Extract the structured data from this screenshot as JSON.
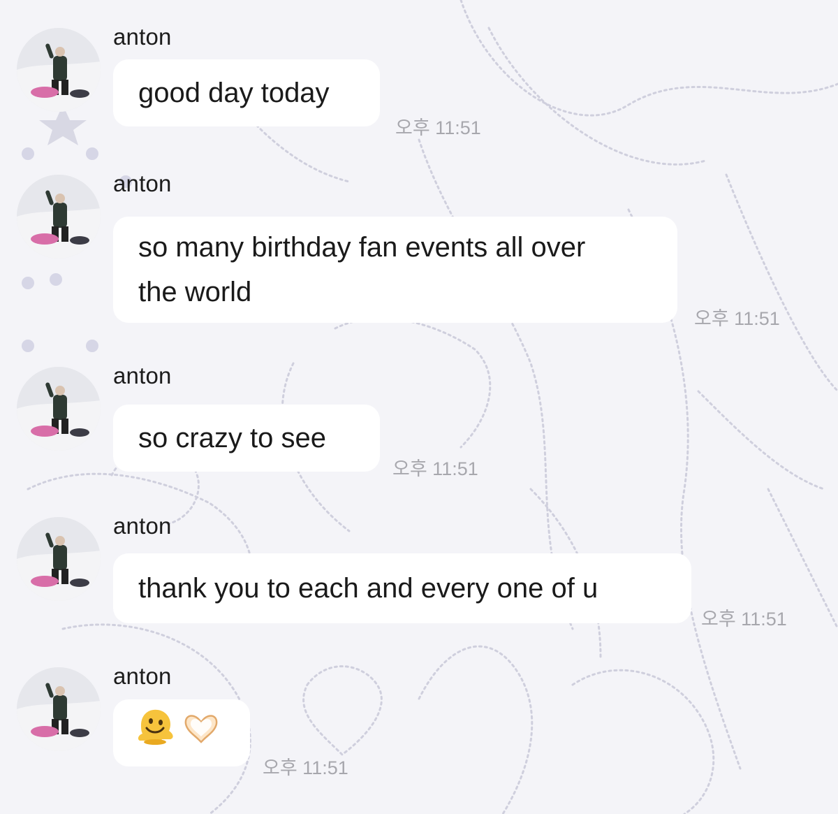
{
  "chat": {
    "messages": [
      {
        "sender": "anton",
        "text": "good day today",
        "time": "오후 11:51"
      },
      {
        "sender": "anton",
        "text_lines": [
          "so many birthday fan events all over",
          "the world"
        ],
        "time": "오후 11:51"
      },
      {
        "sender": "anton",
        "text": "so crazy to see",
        "time": "오후 11:51"
      },
      {
        "sender": "anton",
        "text": "thank you to each and every one of u",
        "time": "오후 11:51"
      },
      {
        "sender": "anton",
        "emojis": [
          "melting-face-emoji",
          "heart-hands-emoji"
        ],
        "time": "오후 11:51"
      }
    ]
  },
  "colors": {
    "background": "#f4f4f8",
    "bubble": "#ffffff",
    "timestamp": "#a7a7ad",
    "doodle": "#c9c9d8"
  }
}
